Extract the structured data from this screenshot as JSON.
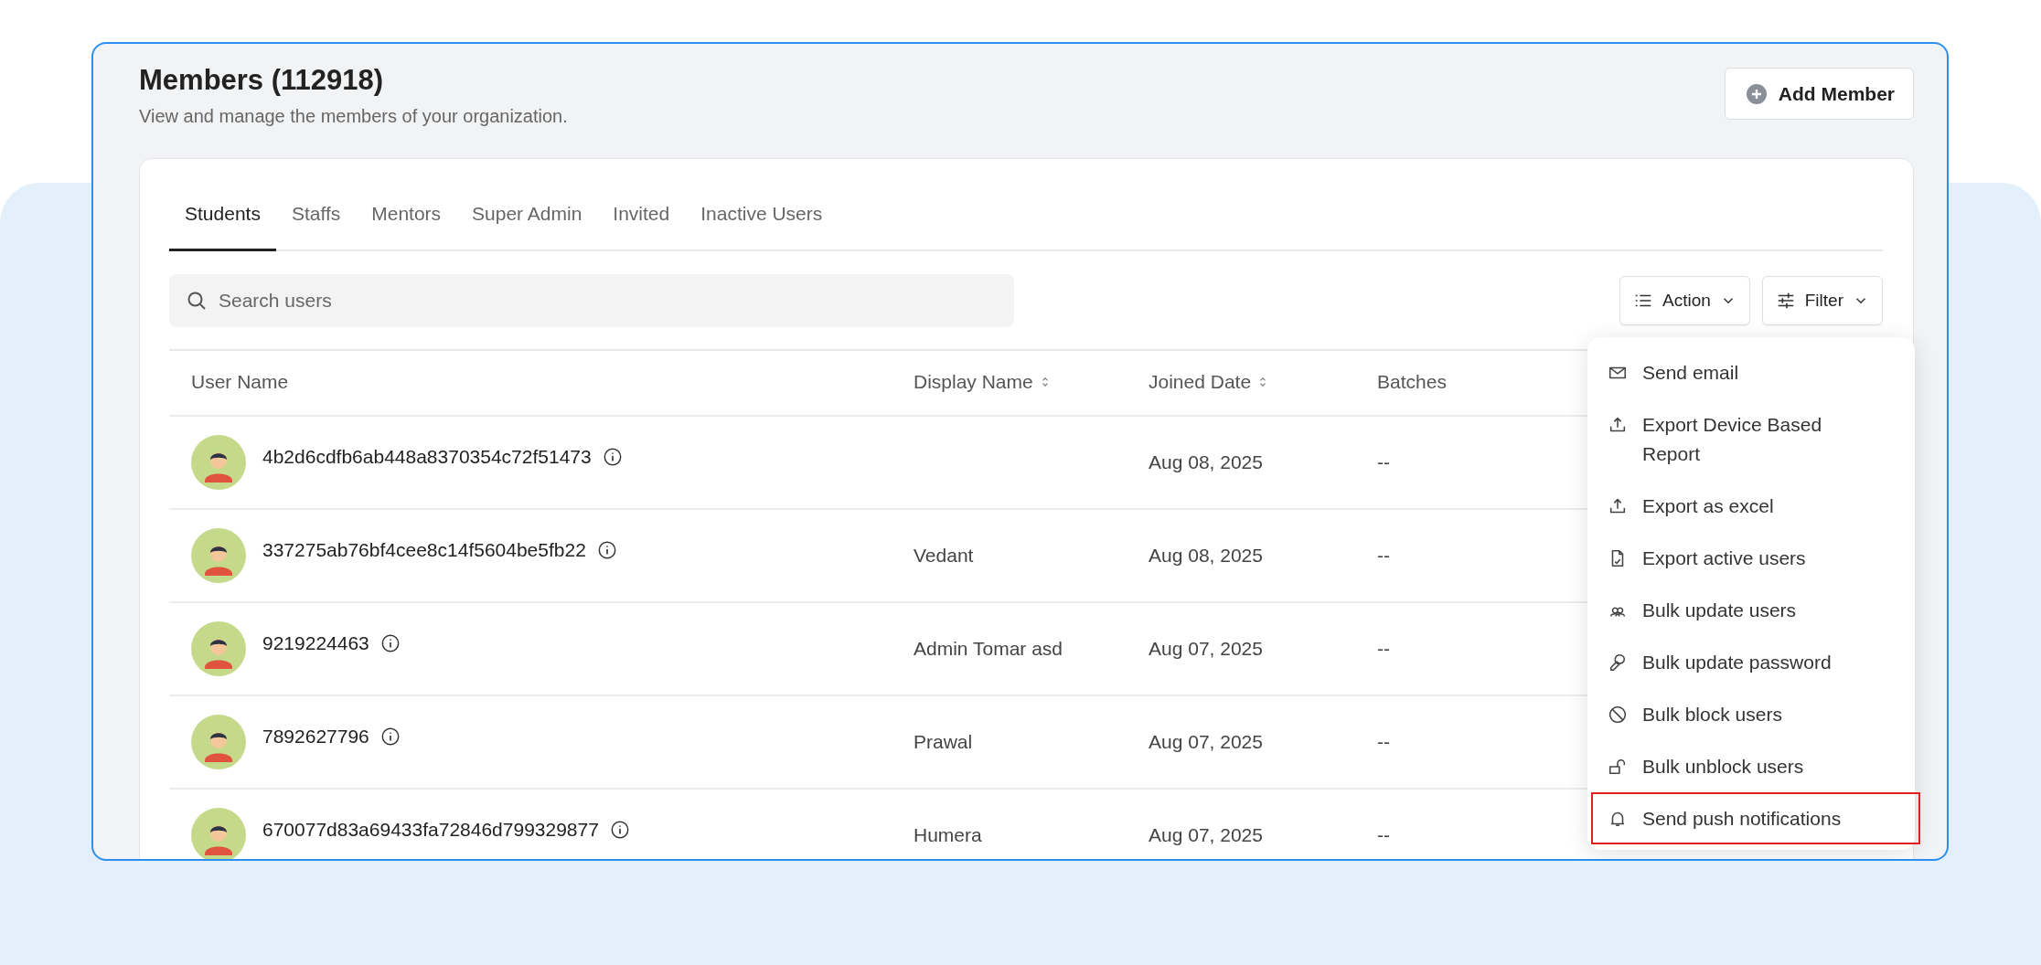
{
  "header": {
    "title": "Members (112918)",
    "subtitle": "View and manage the members of your organization.",
    "add_button": "Add Member"
  },
  "tabs": [
    {
      "label": "Students",
      "selected": true
    },
    {
      "label": "Staffs",
      "selected": false
    },
    {
      "label": "Mentors",
      "selected": false
    },
    {
      "label": "Super Admin",
      "selected": false
    },
    {
      "label": "Invited",
      "selected": false
    },
    {
      "label": "Inactive Users",
      "selected": false
    }
  ],
  "search": {
    "placeholder": "Search users"
  },
  "toolbar": {
    "action_button": "Action",
    "filter_button": "Filter"
  },
  "table": {
    "columns": [
      {
        "label": "User Name",
        "sortable": false
      },
      {
        "label": "Display Name",
        "sortable": true
      },
      {
        "label": "Joined Date",
        "sortable": true
      },
      {
        "label": "Batches",
        "sortable": false
      }
    ],
    "rows": [
      {
        "user_name": "4b2d6cdfb6ab448a8370354c72f51473",
        "joined_date": "Aug 08, 2025",
        "batches": "--"
      },
      {
        "user_name": "337275ab76bf4cee8c14f5604be5fb22",
        "display_name": "Vedant",
        "joined_date": "Aug 08, 2025",
        "batches": "--"
      },
      {
        "user_name": "9219224463",
        "display_name": "Admin Tomar asd",
        "joined_date": "Aug 07, 2025",
        "batches": "--"
      },
      {
        "user_name": "7892627796",
        "display_name": "Prawal",
        "joined_date": "Aug 07, 2025",
        "batches": "--"
      },
      {
        "user_name": "670077d83a69433fa72846d799329877",
        "display_name": "Humera",
        "joined_date": "Aug 07, 2025",
        "batches": "--"
      }
    ]
  },
  "action_menu": [
    {
      "label": "Send email",
      "highlighted": false
    },
    {
      "label": "Export Device Based Report",
      "highlighted": false
    },
    {
      "label": "Export as excel",
      "highlighted": false
    },
    {
      "label": "Export active users",
      "highlighted": false
    },
    {
      "label": "Bulk update users",
      "highlighted": false
    },
    {
      "label": "Bulk update password",
      "highlighted": false
    },
    {
      "label": "Bulk block users",
      "highlighted": false
    },
    {
      "label": "Bulk unblock users",
      "highlighted": false
    },
    {
      "label": "Send push notifications",
      "highlighted": true
    }
  ]
}
